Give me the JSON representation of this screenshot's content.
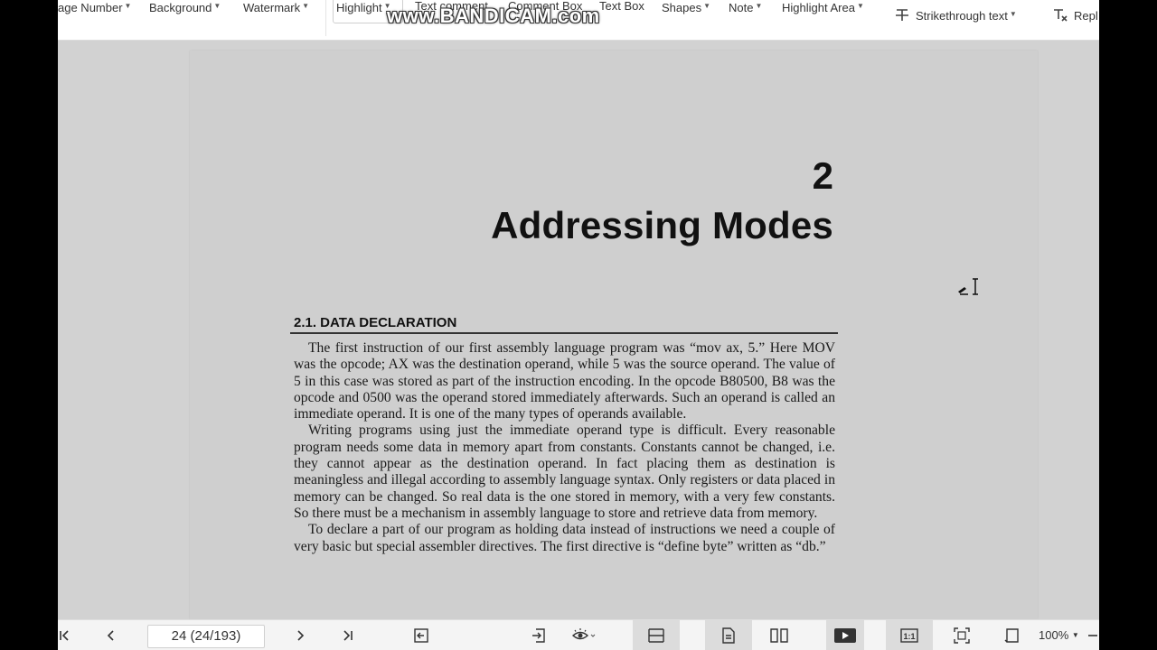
{
  "toolbar": {
    "items": [
      {
        "label": "age Number"
      },
      {
        "label": "Background"
      },
      {
        "label": "Watermark"
      },
      {
        "label": "Highlight"
      },
      {
        "label": "Text comment"
      },
      {
        "label": "Comment Box"
      },
      {
        "label": "Text Box"
      },
      {
        "label": "Shapes"
      },
      {
        "label": "Note"
      },
      {
        "label": "Highlight Area"
      }
    ],
    "strikethrough_label": "Strikethrough text",
    "replace_label": "Repl"
  },
  "watermark_overlay": "www.BANDICAM.com",
  "document": {
    "chapter_number": "2",
    "chapter_title": "Addressing Modes",
    "section_heading": "2.1. DATA DECLARATION",
    "paragraphs": [
      "The first instruction of our first assembly language program was “mov ax, 5.” Here MOV was the opcode; AX was the destination operand, while 5 was the source operand. The value of 5 in this case was stored as part of the instruction encoding. In the opcode B80500, B8 was the opcode and 0500 was the operand stored immediately afterwards. Such an operand is called an immediate operand. It is one of the many types of operands available.",
      "Writing programs using just the immediate operand type is difficult. Every reasonable program needs some data in memory apart from constants. Constants cannot be changed, i.e. they cannot appear as the destination operand. In fact placing them as destination is meaningless and illegal according to assembly language syntax. Only registers or data placed in memory can be changed. So real data is the one stored in memory, with a very few constants. So there must be a mechanism in assembly language to store and retrieve data from memory.",
      "To declare a part of our program as holding data instead of instructions we need a couple of very basic but special assembler directives. The first directive is “define byte” written as “db.”"
    ]
  },
  "bottombar": {
    "page_indicator": "24 (24/193)",
    "zoom": "100%"
  }
}
